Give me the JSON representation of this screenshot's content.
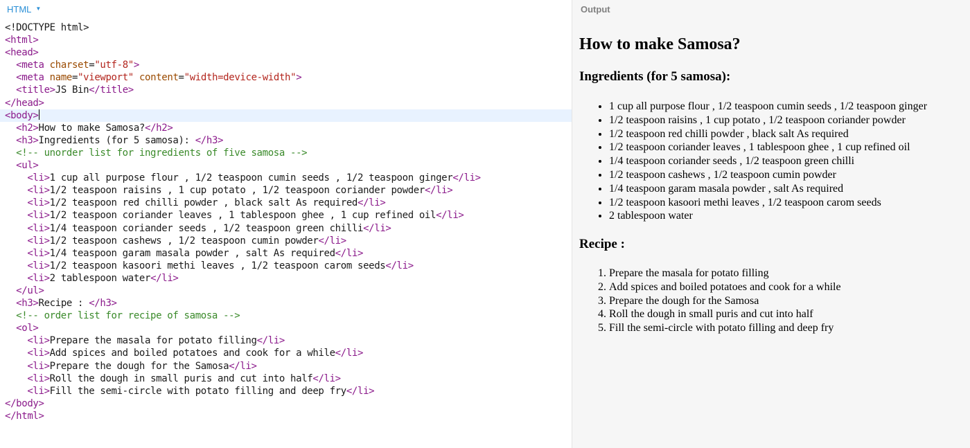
{
  "editor": {
    "panel_label": "HTML",
    "panel_caret": "▼",
    "code_lines": [
      [
        {
          "t": "text",
          "v": "<!DOCTYPE html>"
        }
      ],
      [
        {
          "t": "tag",
          "v": "<html>"
        }
      ],
      [
        {
          "t": "tag",
          "v": "<head>"
        }
      ],
      [
        {
          "t": "text",
          "v": "  "
        },
        {
          "t": "tag",
          "v": "<meta "
        },
        {
          "t": "attr",
          "v": "charset"
        },
        {
          "t": "text",
          "v": "="
        },
        {
          "t": "str",
          "v": "\"utf-8\""
        },
        {
          "t": "tag",
          "v": ">"
        }
      ],
      [
        {
          "t": "text",
          "v": "  "
        },
        {
          "t": "tag",
          "v": "<meta "
        },
        {
          "t": "attr",
          "v": "name"
        },
        {
          "t": "text",
          "v": "="
        },
        {
          "t": "str",
          "v": "\"viewport\""
        },
        {
          "t": "text",
          "v": " "
        },
        {
          "t": "attr",
          "v": "content"
        },
        {
          "t": "text",
          "v": "="
        },
        {
          "t": "str",
          "v": "\"width=device-width\""
        },
        {
          "t": "tag",
          "v": ">"
        }
      ],
      [
        {
          "t": "text",
          "v": "  "
        },
        {
          "t": "tag",
          "v": "<title>"
        },
        {
          "t": "text",
          "v": "JS Bin"
        },
        {
          "t": "tag",
          "v": "</title>"
        }
      ],
      [
        {
          "t": "tag",
          "v": "</head>"
        }
      ],
      [
        {
          "t": "tag",
          "v": "<body>"
        }
      ],
      [
        {
          "t": "text",
          "v": "  "
        },
        {
          "t": "tag",
          "v": "<h2>"
        },
        {
          "t": "text",
          "v": "How to make Samosa?"
        },
        {
          "t": "tag",
          "v": "</h2>"
        }
      ],
      [
        {
          "t": "text",
          "v": "  "
        },
        {
          "t": "tag",
          "v": "<h3>"
        },
        {
          "t": "text",
          "v": "Ingredients (for 5 samosa): "
        },
        {
          "t": "tag",
          "v": "</h3>"
        }
      ],
      [
        {
          "t": "text",
          "v": "  "
        },
        {
          "t": "comment",
          "v": "<!-- unorder list for ingredients of five samosa -->"
        }
      ],
      [
        {
          "t": "text",
          "v": "  "
        },
        {
          "t": "tag",
          "v": "<ul>"
        }
      ],
      [
        {
          "t": "text",
          "v": "    "
        },
        {
          "t": "tag",
          "v": "<li>"
        },
        {
          "t": "text",
          "v": "1 cup all purpose flour , 1/2 teaspoon cumin seeds , 1/2 teaspoon ginger"
        },
        {
          "t": "tag",
          "v": "</li>"
        }
      ],
      [
        {
          "t": "text",
          "v": "    "
        },
        {
          "t": "tag",
          "v": "<li>"
        },
        {
          "t": "text",
          "v": "1/2 teaspoon raisins , 1 cup potato , 1/2 teaspoon coriander powder"
        },
        {
          "t": "tag",
          "v": "</li>"
        }
      ],
      [
        {
          "t": "text",
          "v": "    "
        },
        {
          "t": "tag",
          "v": "<li>"
        },
        {
          "t": "text",
          "v": "1/2 teaspoon red chilli powder , black salt As required"
        },
        {
          "t": "tag",
          "v": "</li>"
        }
      ],
      [
        {
          "t": "text",
          "v": "    "
        },
        {
          "t": "tag",
          "v": "<li>"
        },
        {
          "t": "text",
          "v": "1/2 teaspoon coriander leaves , 1 tablespoon ghee , 1 cup refined oil"
        },
        {
          "t": "tag",
          "v": "</li>"
        }
      ],
      [
        {
          "t": "text",
          "v": "    "
        },
        {
          "t": "tag",
          "v": "<li>"
        },
        {
          "t": "text",
          "v": "1/4 teaspoon coriander seeds , 1/2 teaspoon green chilli"
        },
        {
          "t": "tag",
          "v": "</li>"
        }
      ],
      [
        {
          "t": "text",
          "v": "    "
        },
        {
          "t": "tag",
          "v": "<li>"
        },
        {
          "t": "text",
          "v": "1/2 teaspoon cashews , 1/2 teaspoon cumin powder"
        },
        {
          "t": "tag",
          "v": "</li>"
        }
      ],
      [
        {
          "t": "text",
          "v": "    "
        },
        {
          "t": "tag",
          "v": "<li>"
        },
        {
          "t": "text",
          "v": "1/4 teaspoon garam masala powder , salt As required"
        },
        {
          "t": "tag",
          "v": "</li>"
        }
      ],
      [
        {
          "t": "text",
          "v": "    "
        },
        {
          "t": "tag",
          "v": "<li>"
        },
        {
          "t": "text",
          "v": "1/2 teaspoon kasoori methi leaves , 1/2 teaspoon carom seeds"
        },
        {
          "t": "tag",
          "v": "</li>"
        }
      ],
      [
        {
          "t": "text",
          "v": "    "
        },
        {
          "t": "tag",
          "v": "<li>"
        },
        {
          "t": "text",
          "v": "2 tablespoon water"
        },
        {
          "t": "tag",
          "v": "</li>"
        }
      ],
      [
        {
          "t": "text",
          "v": "  "
        },
        {
          "t": "tag",
          "v": "</ul>"
        }
      ],
      [
        {
          "t": "text",
          "v": "  "
        },
        {
          "t": "tag",
          "v": "<h3>"
        },
        {
          "t": "text",
          "v": "Recipe : "
        },
        {
          "t": "tag",
          "v": "</h3>"
        }
      ],
      [
        {
          "t": "text",
          "v": "  "
        },
        {
          "t": "comment",
          "v": "<!-- order list for recipe of samosa -->"
        }
      ],
      [
        {
          "t": "text",
          "v": "  "
        },
        {
          "t": "tag",
          "v": "<ol>"
        }
      ],
      [
        {
          "t": "text",
          "v": "    "
        },
        {
          "t": "tag",
          "v": "<li>"
        },
        {
          "t": "text",
          "v": "Prepare the masala for potato filling"
        },
        {
          "t": "tag",
          "v": "</li>"
        }
      ],
      [
        {
          "t": "text",
          "v": "    "
        },
        {
          "t": "tag",
          "v": "<li>"
        },
        {
          "t": "text",
          "v": "Add spices and boiled potatoes and cook for a while"
        },
        {
          "t": "tag",
          "v": "</li>"
        }
      ],
      [
        {
          "t": "text",
          "v": "    "
        },
        {
          "t": "tag",
          "v": "<li>"
        },
        {
          "t": "text",
          "v": "Prepare the dough for the Samosa"
        },
        {
          "t": "tag",
          "v": "</li>"
        }
      ],
      [
        {
          "t": "text",
          "v": "    "
        },
        {
          "t": "tag",
          "v": "<li>"
        },
        {
          "t": "text",
          "v": "Roll the dough in small puris and cut into half"
        },
        {
          "t": "tag",
          "v": "</li>"
        }
      ],
      [
        {
          "t": "text",
          "v": "    "
        },
        {
          "t": "tag",
          "v": "<li>"
        },
        {
          "t": "text",
          "v": "Fill the semi-circle with potato filling and deep fry"
        },
        {
          "t": "tag",
          "v": "</li>"
        }
      ],
      [
        {
          "t": "tag",
          "v": "</body>"
        }
      ],
      [
        {
          "t": "tag",
          "v": "</html>"
        }
      ]
    ],
    "active_line": 7
  },
  "output": {
    "panel_label": "Output",
    "heading": "How to make Samosa?",
    "ingredients_heading": "Ingredients (for 5 samosa):",
    "ingredients": [
      "1 cup all purpose flour , 1/2 teaspoon cumin seeds , 1/2 teaspoon ginger",
      "1/2 teaspoon raisins , 1 cup potato , 1/2 teaspoon coriander powder",
      "1/2 teaspoon red chilli powder , black salt As required",
      "1/2 teaspoon coriander leaves , 1 tablespoon ghee , 1 cup refined oil",
      "1/4 teaspoon coriander seeds , 1/2 teaspoon green chilli",
      "1/2 teaspoon cashews , 1/2 teaspoon cumin powder",
      "1/4 teaspoon garam masala powder , salt As required",
      "1/2 teaspoon kasoori methi leaves , 1/2 teaspoon carom seeds",
      "2 tablespoon water"
    ],
    "recipe_heading": "Recipe :",
    "recipe_steps": [
      "Prepare the masala for potato filling",
      "Add spices and boiled potatoes and cook for a while",
      "Prepare the dough for the Samosa",
      "Roll the dough in small puris and cut into half",
      "Fill the semi-circle with potato filling and deep fry"
    ]
  },
  "colors": {
    "tag": "#8b1a8b",
    "attribute": "#9a4a00",
    "string": "#b3261e",
    "comment": "#3a8a2a",
    "panel_label_html": "#2a8fd6",
    "panel_label_output": "#808080",
    "active_line_bg": "#e8f2ff",
    "output_bg": "#f6f6f6"
  }
}
